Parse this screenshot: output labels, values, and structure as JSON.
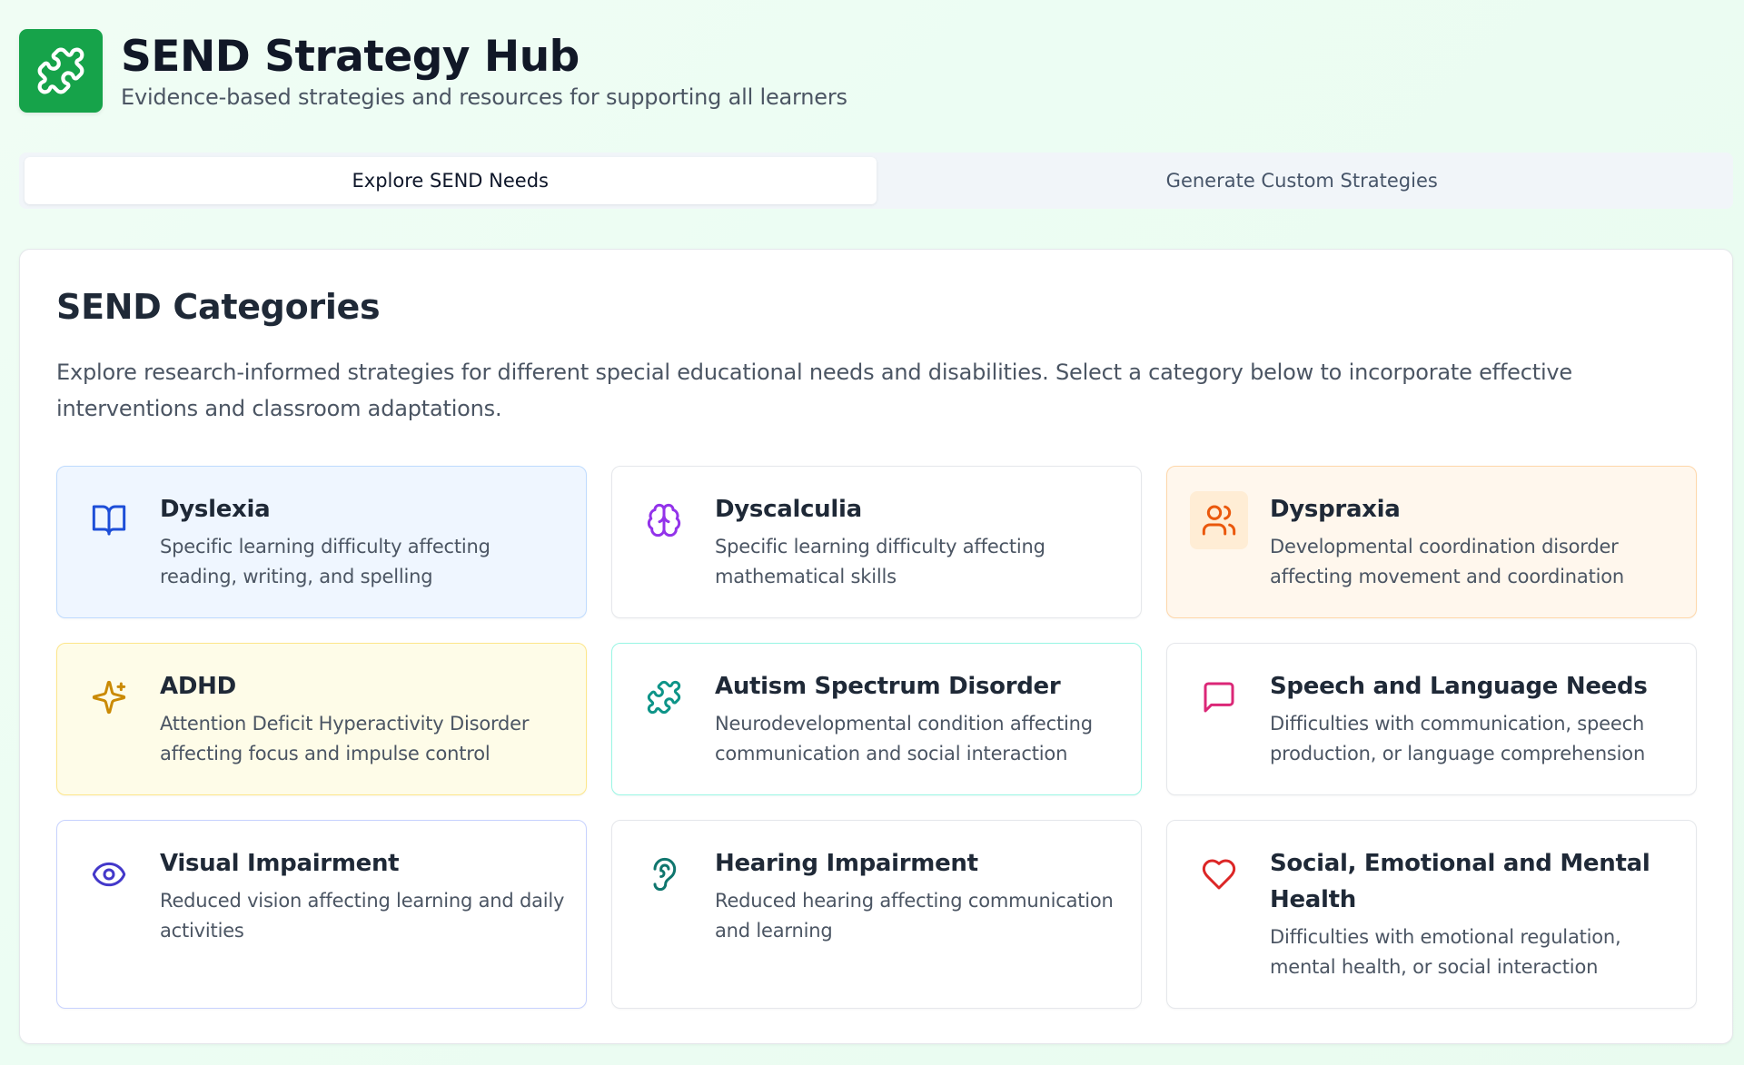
{
  "app": {
    "title": "SEND Strategy Hub",
    "subtitle": "Evidence-based strategies and resources for supporting all learners",
    "logo_icon": "puzzle-icon",
    "brand_color": "#16a34a"
  },
  "tabs": [
    {
      "label": "Explore SEND Needs",
      "active": true
    },
    {
      "label": "Generate Custom Strategies",
      "active": false
    }
  ],
  "panel": {
    "title": "SEND Categories",
    "description": "Explore research-informed strategies for different special educational needs and disabilities. Select a category below to incorporate effective interventions and classroom adaptations."
  },
  "categories": [
    {
      "title": "Dyslexia",
      "description": "Specific learning difficulty affecting reading, writing, and spelling",
      "icon": "book-open-icon",
      "color": "#1d4ed8",
      "bg": "#eff6ff",
      "border": "#bfdbfe"
    },
    {
      "title": "Dyscalculia",
      "description": "Specific learning difficulty affecting mathematical skills",
      "icon": "brain-icon",
      "color": "#9333ea",
      "bg": "#ffffff",
      "border": "#e5e7eb"
    },
    {
      "title": "Dyspraxia",
      "description": "Developmental coordination disorder affecting movement and coordination",
      "icon": "users-icon",
      "color": "#ea580c",
      "bg": "#fff7ed",
      "border": "#fed7aa"
    },
    {
      "title": "ADHD",
      "description": "Attention Deficit Hyperactivity Disorder affecting focus and impulse control",
      "icon": "sparkles-icon",
      "color": "#ca8a04",
      "bg": "#fefce8",
      "border": "#fde68a"
    },
    {
      "title": "Autism Spectrum Disorder",
      "description": "Neurodevelopmental condition affecting communication and social interaction",
      "icon": "puzzle-icon",
      "color": "#0d9488",
      "bg": "#ffffff",
      "border": "#99f6e4"
    },
    {
      "title": "Speech and Language Needs",
      "description": "Difficulties with communication, speech production, or language comprehension",
      "icon": "message-square-icon",
      "color": "#db2777",
      "bg": "#ffffff",
      "border": "#e5e7eb"
    },
    {
      "title": "Visual Impairment",
      "description": "Reduced vision affecting learning and daily activities",
      "icon": "eye-icon",
      "color": "#4338ca",
      "bg": "#ffffff",
      "border": "#c7d2fe"
    },
    {
      "title": "Hearing Impairment",
      "description": "Reduced hearing affecting communication and learning",
      "icon": "ear-icon",
      "color": "#0f766e",
      "bg": "#ffffff",
      "border": "#e5e7eb"
    },
    {
      "title": "Social, Emotional and Mental Health",
      "description": "Difficulties with emotional regulation, mental health, or social interaction",
      "icon": "heart-icon",
      "color": "#dc2626",
      "bg": "#ffffff",
      "border": "#e5e7eb"
    }
  ]
}
